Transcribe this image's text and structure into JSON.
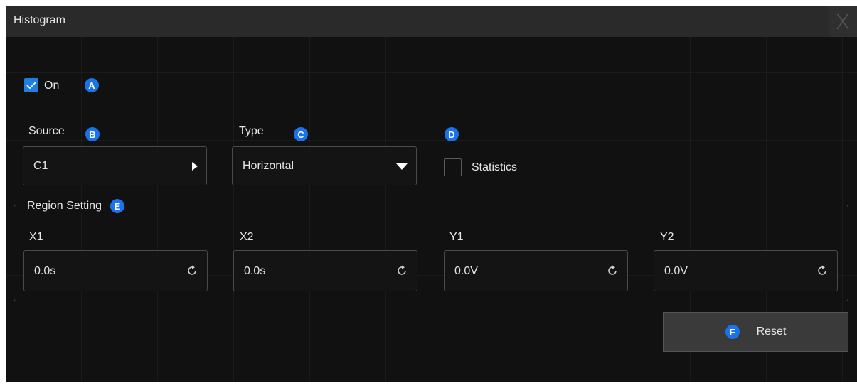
{
  "dialog": {
    "title": "Histogram"
  },
  "on_toggle": {
    "label": "On",
    "checked": true,
    "badge": "A"
  },
  "source": {
    "label": "Source",
    "badge": "B",
    "value": "C1"
  },
  "type": {
    "label": "Type",
    "badge": "C",
    "value": "Horizontal"
  },
  "statistics": {
    "badge": "D",
    "label": "Statistics",
    "checked": false
  },
  "region": {
    "title": "Region Setting",
    "badge": "E",
    "fields": [
      {
        "label": "X1",
        "value": "0.0s"
      },
      {
        "label": "X2",
        "value": "0.0s"
      },
      {
        "label": "Y1",
        "value": "0.0V"
      },
      {
        "label": "Y2",
        "value": "0.0V"
      }
    ]
  },
  "reset": {
    "badge": "F",
    "label": "Reset"
  },
  "colors": {
    "accent": "#1a73e8",
    "background": "#111111",
    "titlebar": "#2a2a2a"
  }
}
